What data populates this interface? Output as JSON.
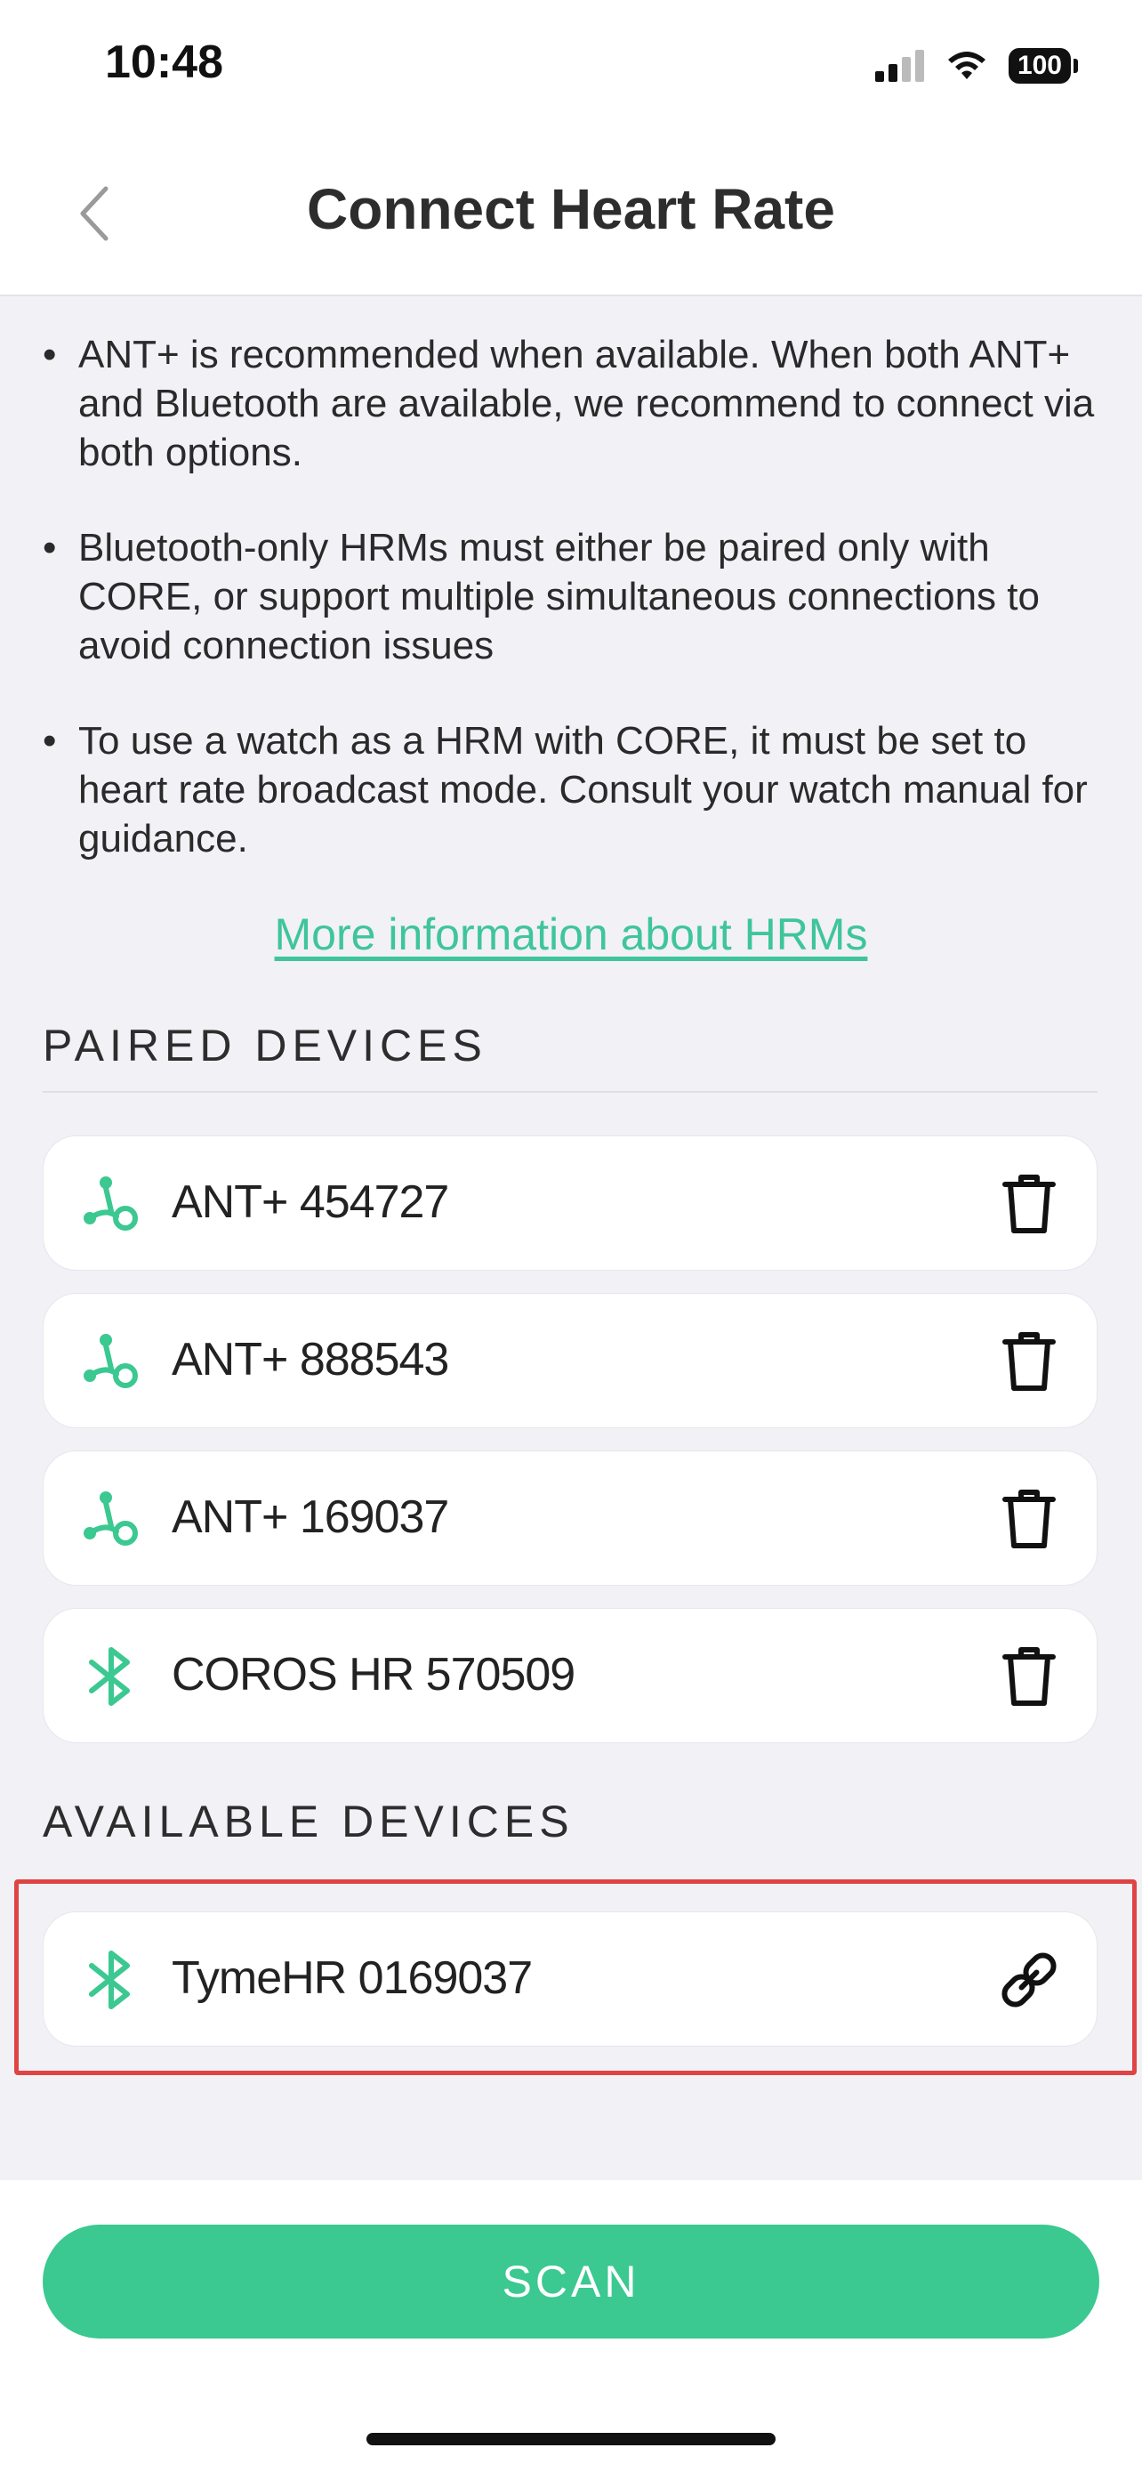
{
  "status_bar": {
    "time": "10:48",
    "battery": "100"
  },
  "header": {
    "title": "Connect Heart Rate"
  },
  "info": {
    "bullets": [
      "ANT+ is recommended when available. When both ANT+ and Bluetooth are available, we recommend to connect via both options.",
      "Bluetooth-only HRMs must either be paired only with CORE, or support multiple simultaneous connections to avoid connection issues",
      "To use a watch as a HRM with CORE, it must be set to heart rate broadcast mode. Consult your watch manual for guidance."
    ],
    "link": "More information about HRMs"
  },
  "paired": {
    "label": "PAIRED DEVICES",
    "devices": [
      {
        "name": "ANT+ 454727",
        "type": "ant-icon",
        "action": "trash-icon"
      },
      {
        "name": "ANT+ 888543",
        "type": "ant-icon",
        "action": "trash-icon"
      },
      {
        "name": "ANT+ 169037",
        "type": "ant-icon",
        "action": "trash-icon"
      },
      {
        "name": "COROS HR 570509",
        "type": "bluetooth-icon",
        "action": "trash-icon"
      }
    ]
  },
  "available": {
    "label": "AVAILABLE DEVICES",
    "devices": [
      {
        "name": "TymeHR 0169037",
        "type": "bluetooth-icon",
        "action": "link-icon"
      }
    ]
  },
  "scan_button": "SCAN",
  "colors": {
    "accent": "#3bc891",
    "link": "#3fc59a",
    "highlight": "#e04343",
    "background": "#f1f1f6"
  }
}
